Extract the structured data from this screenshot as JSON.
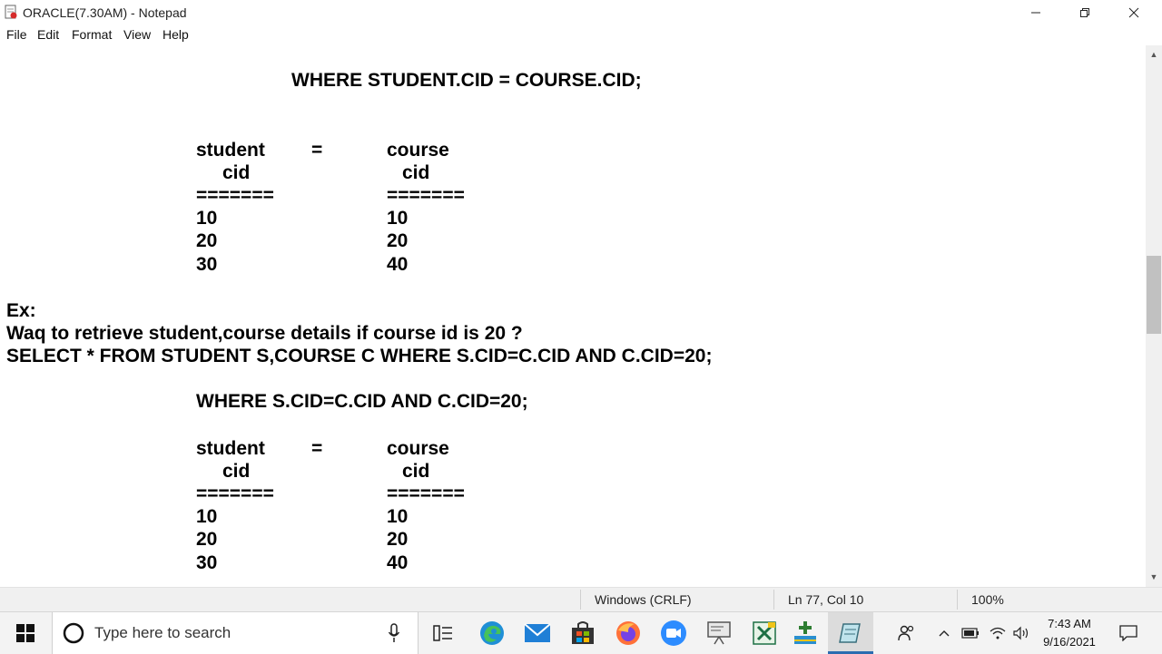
{
  "window": {
    "title": "ORACLE(7.30AM) - Notepad"
  },
  "menu": [
    "File",
    "Edit",
    "Format",
    "View",
    "Help"
  ],
  "document": {
    "line1": "WHERE STUDENT.CID = COURSE.CID;",
    "table1": {
      "left_header": "student",
      "equals": "=",
      "right_header": "course",
      "left_sub": "cid",
      "right_sub": "cid",
      "left_rule": "=======",
      "right_rule": "=======",
      "rows": [
        [
          "10",
          "10"
        ],
        [
          "20",
          "20"
        ],
        [
          "30",
          "40"
        ]
      ]
    },
    "ex_label": "Ex:",
    "question": "Waq to retrieve student,course details if course id is 20 ?",
    "query": "SELECT * FROM STUDENT S,COURSE C WHERE S.CID=C.CID AND C.CID=20;",
    "line2": "WHERE S.CID=C.CID AND C.CID=20;",
    "table2": {
      "left_header": "student",
      "equals": "=",
      "right_header": "course",
      "left_sub": "cid",
      "right_sub": "cid",
      "left_rule": "=======",
      "right_rule": "=======",
      "rows": [
        [
          "10",
          "10"
        ],
        [
          "20",
          "20"
        ],
        [
          "30",
          "40"
        ]
      ]
    }
  },
  "status": {
    "encoding": "Windows (CRLF)",
    "position": "Ln 77, Col 10",
    "zoom": "100%"
  },
  "taskbar": {
    "search_placeholder": "Type here to search",
    "time": "7:43 AM",
    "date": "9/16/2021",
    "apps": [
      "task-view-icon",
      "edge-icon",
      "mail-icon",
      "store-icon",
      "firefox-icon",
      "zoom-icon",
      "presentation-icon",
      "excel-icon",
      "app-plus-icon",
      "notepad-icon"
    ]
  }
}
